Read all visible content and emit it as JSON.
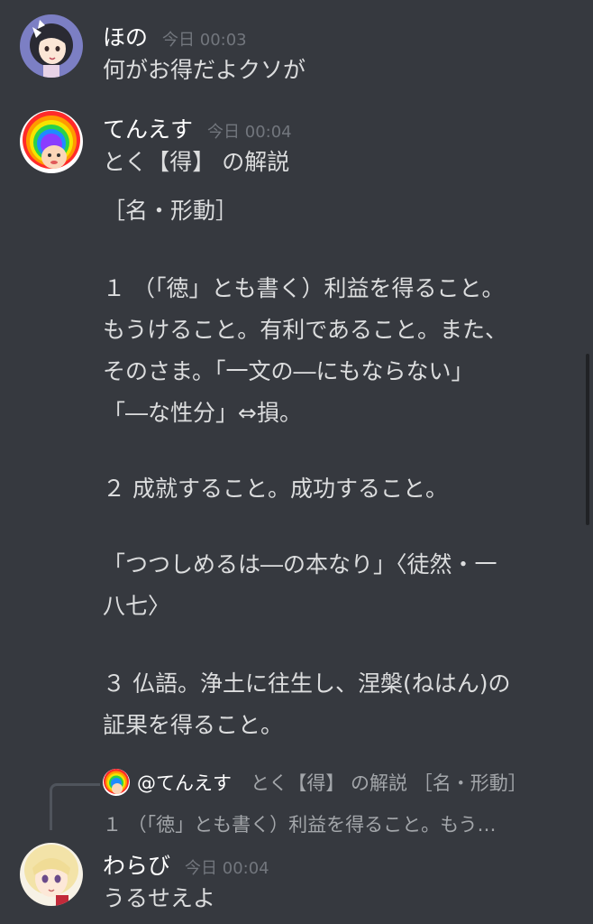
{
  "messages": [
    {
      "username": "ほの",
      "timestamp": "今日 00:03",
      "text": "何がお得だよクソが"
    },
    {
      "username": "てんえす",
      "timestamp": "今日 00:04",
      "text": "とく【得】 の解説",
      "lines": [
        "［名・形動］",
        "",
        "１ （「徳」とも書く）利益を得ること。",
        "もうけること。有利であること。また、",
        "そのさま。「一文の―にもならない」",
        "「―な性分」⇔損。",
        "",
        "２ 成就すること。成功すること。",
        "",
        "「つつしめるは―の本なり」〈徒然・一",
        "八七〉",
        "",
        "３ 仏語。浄土に往生し、涅槃(ねはん)の",
        "証果を得ること。"
      ]
    },
    {
      "username": "わらび",
      "timestamp": "今日 00:04",
      "text": "うるせえよ",
      "reply": {
        "mention": "@てんえす",
        "preview_line1": "とく【得】 の解説 ［名・形動］",
        "preview_line2": "１ （「徳」とも書く）利益を得ること。もう…"
      }
    }
  ],
  "colors": {
    "background": "#36393f",
    "username": "#ffffff",
    "timestamp": "#72767d",
    "text": "#dcddde",
    "reply_text": "#a3a6aa"
  },
  "icons": {
    "avatar_hono": "anime-girl-avatar",
    "avatar_tenesu": "rainbow-afro-avatar",
    "avatar_warabi": "blonde-girl-avatar"
  }
}
